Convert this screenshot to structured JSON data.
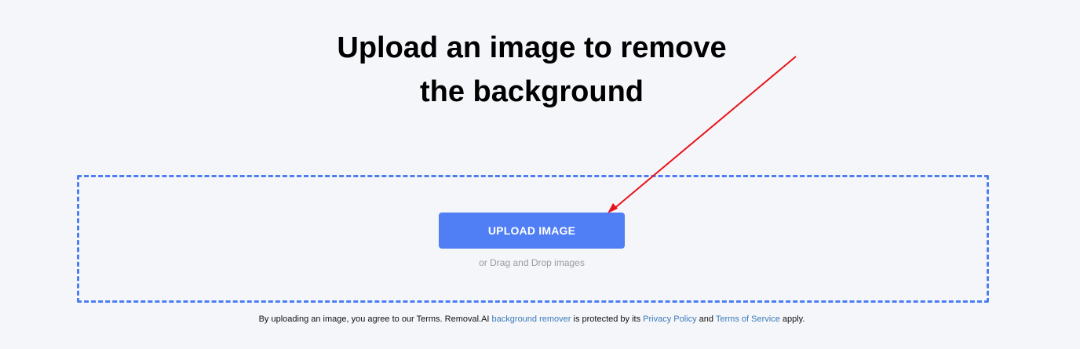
{
  "heading": {
    "line1": "Upload an image to remove",
    "line2": "the background"
  },
  "dropzone": {
    "upload_button_label": "UPLOAD IMAGE",
    "drag_hint": "or Drag and Drop images"
  },
  "footer": {
    "text_before": "By uploading an image, you agree to our Terms. Removal.AI ",
    "link_background_remover": "background remover",
    "text_middle": " is protected by its ",
    "link_privacy_policy": "Privacy Policy",
    "text_and": " and ",
    "link_terms_of_service": "Terms of Service",
    "text_after": " apply."
  },
  "colors": {
    "accent": "#4f7ef5",
    "dropzone_border": "#4c7ef3",
    "link": "#3a7ab8",
    "annotation_arrow": "#e8141b",
    "background": "#f5f6fa"
  }
}
